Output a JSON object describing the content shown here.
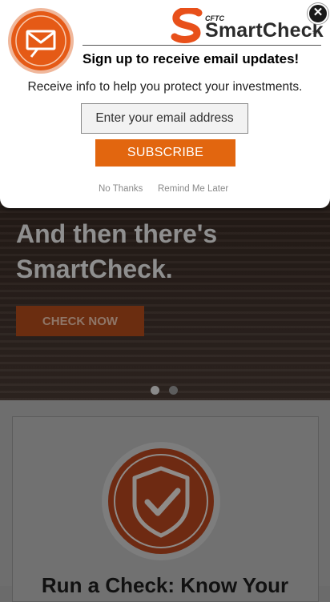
{
  "modal": {
    "logo": {
      "prefix": "CFTC",
      "name": "SmartCheck",
      "mark": "SM"
    },
    "close_icon": "close-icon",
    "title": "Sign up to receive email updates!",
    "subtitle": "Receive info to help you protect your investments.",
    "email_placeholder": "Enter your email address",
    "subscribe_label": "SUBSCRIBE",
    "no_thanks_label": "No Thanks",
    "remind_later_label": "Remind Me Later"
  },
  "hero": {
    "title": "And then there's\nSmartCheck.",
    "button_label": "CHECK NOW",
    "slides": {
      "count": 2,
      "active": 0
    }
  },
  "card": {
    "icon": "shield-check-icon",
    "heading": "Run a Check: Know Your"
  },
  "colors": {
    "accent": "#e2660f",
    "badge": "#e05a1c",
    "text": "#000000"
  }
}
